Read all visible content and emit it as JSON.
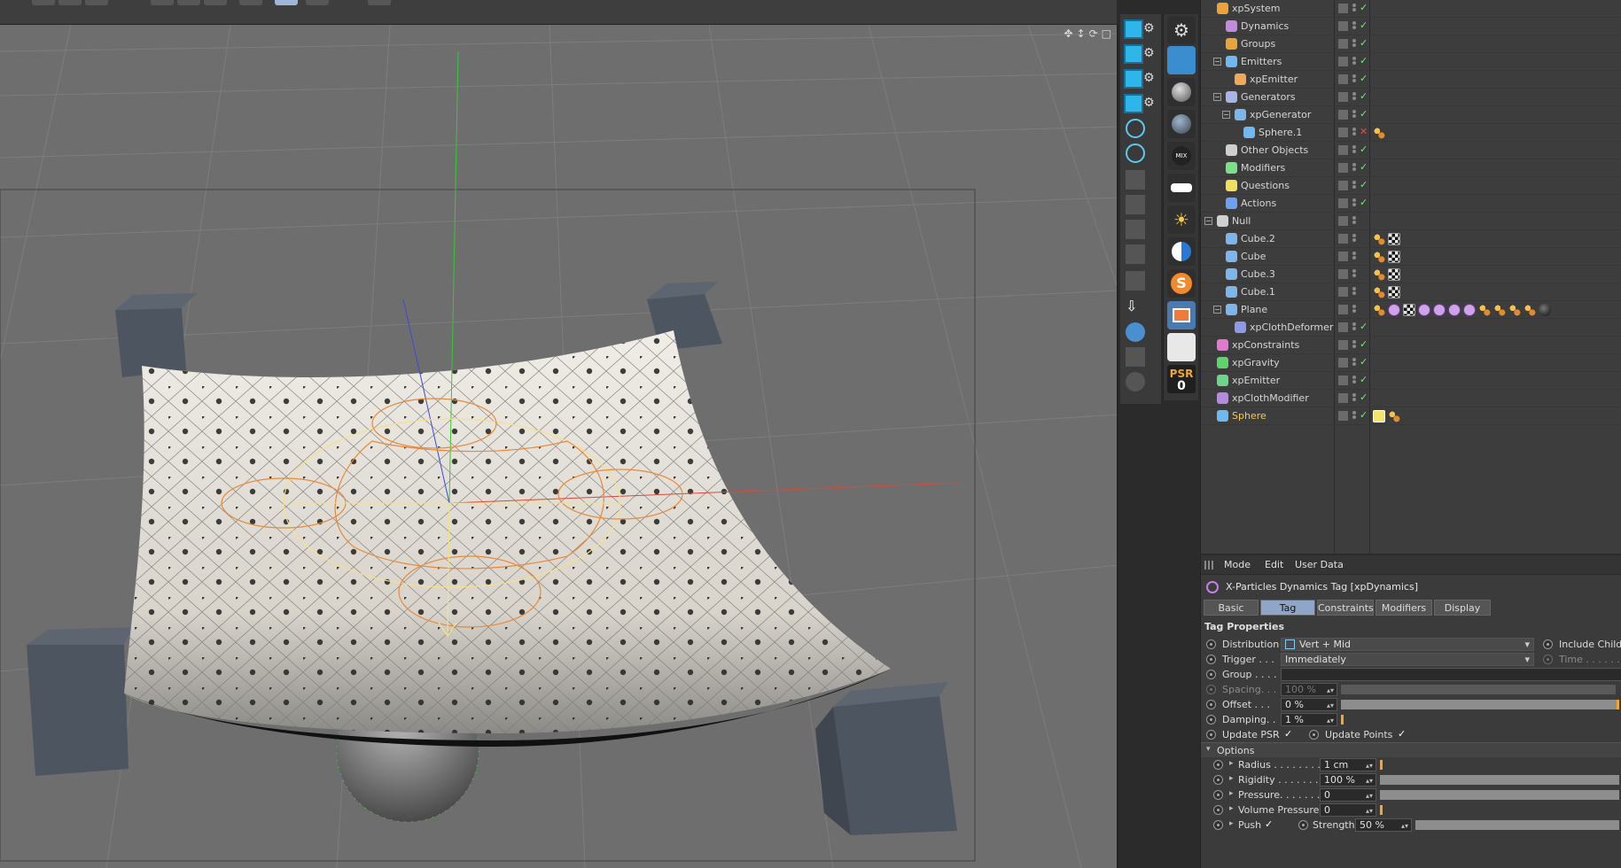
{
  "objects": [
    {
      "name": "xpSystem",
      "depth": 0,
      "icon": "#e8a33a",
      "tree": "",
      "check": "ok",
      "tags": []
    },
    {
      "name": "Dynamics",
      "depth": 1,
      "icon": "#c28be0",
      "tree": "",
      "check": "ok",
      "tags": []
    },
    {
      "name": "Groups",
      "depth": 1,
      "icon": "#e8a33a",
      "tree": "",
      "check": "ok",
      "tags": []
    },
    {
      "name": "Emitters",
      "depth": 1,
      "icon": "#6fb8f0",
      "tree": "-",
      "check": "ok",
      "tags": []
    },
    {
      "name": "xpEmitter",
      "depth": 2,
      "icon": "#f0a85a",
      "tree": "",
      "check": "ok",
      "tags": []
    },
    {
      "name": "Generators",
      "depth": 1,
      "icon": "#a7b4e8",
      "tree": "-",
      "check": "ok",
      "tags": []
    },
    {
      "name": "xpGenerator",
      "depth": 2,
      "icon": "#7fb5e8",
      "tree": "-",
      "check": "ok",
      "tags": []
    },
    {
      "name": "Sphere.1",
      "depth": 3,
      "icon": "#6fb8f0",
      "tree": "",
      "check": "x",
      "tags": [
        "phong"
      ]
    },
    {
      "name": "Other Objects",
      "depth": 1,
      "icon": "#cfcfcf",
      "tree": "",
      "check": "ok",
      "tags": []
    },
    {
      "name": "Modifiers",
      "depth": 1,
      "icon": "#7be08a",
      "tree": "",
      "check": "ok",
      "tags": []
    },
    {
      "name": "Questions",
      "depth": 1,
      "icon": "#f0e060",
      "tree": "",
      "check": "ok",
      "tags": []
    },
    {
      "name": "Actions",
      "depth": 1,
      "icon": "#6f9ff0",
      "tree": "",
      "check": "ok",
      "tags": []
    },
    {
      "name": "Null",
      "depth": 0,
      "icon": "#d0d0d0",
      "tree": "-",
      "check": "",
      "tags": []
    },
    {
      "name": "Cube.2",
      "depth": 1,
      "icon": "#7fb5e8",
      "tree": "",
      "check": "",
      "tags": [
        "phong",
        "tex"
      ]
    },
    {
      "name": "Cube",
      "depth": 1,
      "icon": "#7fb5e8",
      "tree": "",
      "check": "",
      "tags": [
        "phong",
        "tex"
      ]
    },
    {
      "name": "Cube.3",
      "depth": 1,
      "icon": "#7fb5e8",
      "tree": "",
      "check": "",
      "tags": [
        "phong",
        "tex"
      ]
    },
    {
      "name": "Cube.1",
      "depth": 1,
      "icon": "#7fb5e8",
      "tree": "",
      "check": "",
      "tags": [
        "phong",
        "tex"
      ]
    },
    {
      "name": "Plane",
      "depth": 1,
      "icon": "#7fb5e8",
      "tree": "-",
      "check": "",
      "tags": [
        "phong",
        "xp",
        "tex",
        "xp",
        "xp",
        "xp",
        "xp",
        "phong",
        "phong",
        "phong",
        "phong",
        "ball"
      ]
    },
    {
      "name": "xpClothDeformer",
      "depth": 2,
      "icon": "#8e9ae8",
      "tree": "",
      "check": "ok",
      "tags": []
    },
    {
      "name": "xpConstraints",
      "depth": 0,
      "icon": "#e07ad0",
      "tree": "",
      "check": "ok",
      "tags": []
    },
    {
      "name": "xpGravity",
      "depth": 0,
      "icon": "#5ed46b",
      "tree": "",
      "check": "ok",
      "tags": []
    },
    {
      "name": "xpEmitter",
      "depth": 0,
      "icon": "#6cd58b",
      "tree": "",
      "check": "ok",
      "tags": []
    },
    {
      "name": "xpClothModifier",
      "depth": 0,
      "icon": "#b48be0",
      "tree": "",
      "check": "ok",
      "tags": []
    },
    {
      "name": "Sphere",
      "depth": 0,
      "icon": "#6fb8f0",
      "tree": "",
      "check": "ok",
      "active": true,
      "tags": [
        "dyn",
        "phong"
      ]
    }
  ],
  "attr": {
    "menu": [
      "Mode",
      "Edit",
      "User Data"
    ],
    "title": "X-Particles Dynamics Tag [xpDynamics]",
    "tabs": [
      "Basic",
      "Tag",
      "Constraints",
      "Modifiers",
      "Display"
    ],
    "selected_tab": "Tag",
    "section": "Tag Properties",
    "distribution_label": "Distribution",
    "distribution_value": "Vert + Mid",
    "include_children_label": "Include Childr",
    "trigger_label": "Trigger . . .",
    "trigger_value": "Immediately",
    "time_label": "Time . . . . . . .",
    "group_label": "Group . . . .",
    "group_value": "",
    "spacing_label": "Spacing. . .",
    "spacing_value": "100 %",
    "offset_label": "Offset . . .",
    "offset_value": "0 %",
    "damping_label": "Damping. .",
    "damping_value": "1 %",
    "update_psr_label": "Update PSR",
    "update_points_label": "Update Points",
    "options_label": "Options",
    "radius_label": "Radius . . . . . . . .",
    "radius_value": "1 cm",
    "rigidity_label": "Rigidity . . . . . . .",
    "rigidity_value": "100 %",
    "pressure_label": "Pressure. . . . . . .",
    "pressure_value": "0",
    "volume_pressure_label": "Volume Pressure",
    "volume_pressure_value": "0",
    "push_label": "Push",
    "strength_label": "Strength",
    "strength_value": "50 %"
  },
  "psr": {
    "label": "PSR",
    "value": "0"
  },
  "colors": {
    "viewport_bg": "#6e6e6e",
    "cloth": "#e8e4dc",
    "selection_accent": "#8fa6c9",
    "slider_knob": "#f5a623",
    "axis_x": "#d84a3a",
    "axis_y": "#3bc43b",
    "axis_z": "#3a4ad8"
  }
}
